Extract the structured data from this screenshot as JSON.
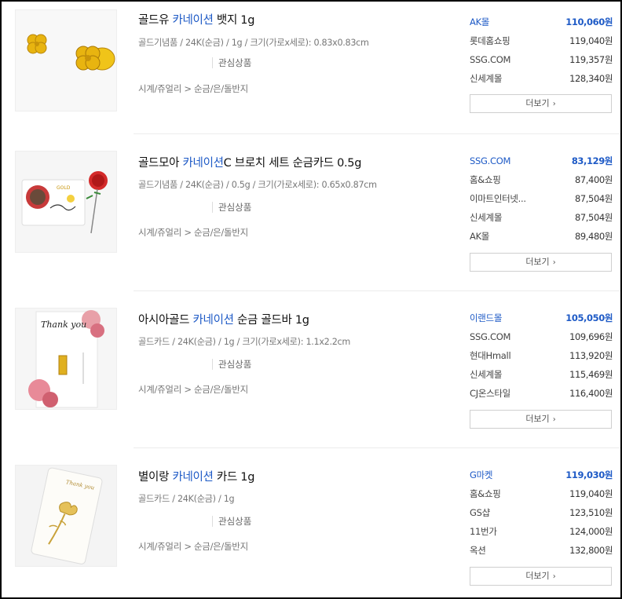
{
  "accent_color": "#1e5ac6",
  "products": [
    {
      "title_prefix": "골드유 ",
      "keyword": "카네이션",
      "title_suffix": " 뱃지 1g",
      "spec": "골드기념품 / 24K(순금) / 1g / 크기(가로x세로): 0.83x0.83cm",
      "wish": "관심상품",
      "category": "시계/쥬얼리 > 순금/은/돌반지",
      "prices": [
        {
          "mall": "AK몰",
          "price": "110,060원"
        },
        {
          "mall": "롯데홈쇼핑",
          "price": "119,040원"
        },
        {
          "mall": "SSG.COM",
          "price": "119,357원"
        },
        {
          "mall": "신세계몰",
          "price": "128,340원"
        }
      ],
      "more_label": "더보기"
    },
    {
      "title_prefix": "골드모아 ",
      "keyword": "카네이션",
      "title_suffix": "C 브로치 세트 순금카드 0.5g",
      "spec": "골드기념품 / 24K(순금) / 0.5g / 크기(가로x세로): 0.65x0.87cm",
      "wish": "관심상품",
      "category": "시계/쥬얼리 > 순금/은/돌반지",
      "prices": [
        {
          "mall": "SSG.COM",
          "price": "83,129원"
        },
        {
          "mall": "홈&쇼핑",
          "price": "87,400원"
        },
        {
          "mall": "이마트인터넷...",
          "price": "87,504원"
        },
        {
          "mall": "신세계몰",
          "price": "87,504원"
        },
        {
          "mall": "AK몰",
          "price": "89,480원"
        }
      ],
      "more_label": "더보기"
    },
    {
      "title_prefix": "아시아골드 ",
      "keyword": "카네이션",
      "title_suffix": " 순금 골드바 1g",
      "spec": "골드카드 / 24K(순금) / 1g / 크기(가로x세로): 1.1x2.2cm",
      "wish": "관심상품",
      "category": "시계/쥬얼리 > 순금/은/돌반지",
      "prices": [
        {
          "mall": "이랜드몰",
          "price": "105,050원"
        },
        {
          "mall": "SSG.COM",
          "price": "109,696원"
        },
        {
          "mall": "현대Hmall",
          "price": "113,920원"
        },
        {
          "mall": "신세계몰",
          "price": "115,469원"
        },
        {
          "mall": "CJ온스타일",
          "price": "116,400원"
        }
      ],
      "more_label": "더보기"
    },
    {
      "title_prefix": "별이랑 ",
      "keyword": "카네이션",
      "title_suffix": " 카드 1g",
      "spec": "골드카드 / 24K(순금) / 1g",
      "wish": "관심상품",
      "category": "시계/쥬얼리 > 순금/은/돌반지",
      "prices": [
        {
          "mall": "G마켓",
          "price": "119,030원"
        },
        {
          "mall": "홈&쇼핑",
          "price": "119,040원"
        },
        {
          "mall": "GS샵",
          "price": "123,510원"
        },
        {
          "mall": "11번가",
          "price": "124,000원"
        },
        {
          "mall": "옥션",
          "price": "132,800원"
        }
      ],
      "more_label": "더보기"
    }
  ],
  "thumb_texts": {
    "card3_script": "Thank you",
    "card4_script": "Thank you"
  }
}
